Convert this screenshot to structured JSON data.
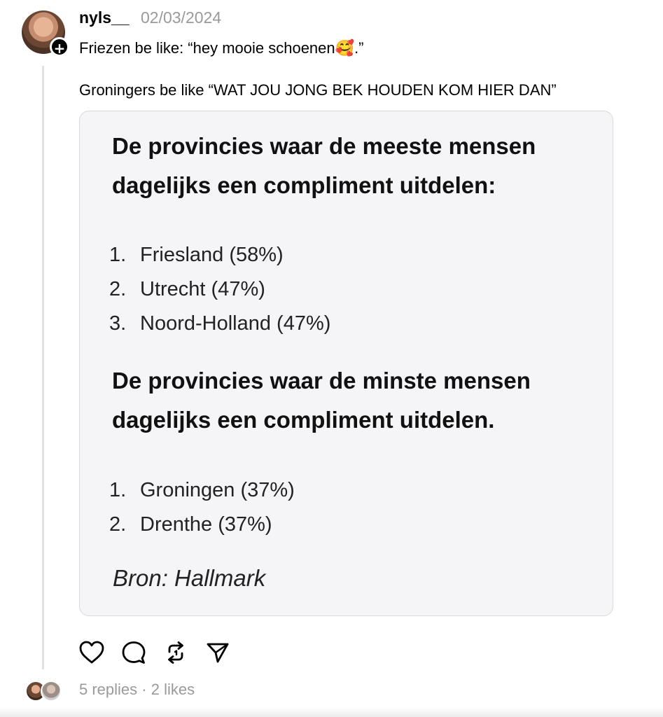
{
  "post": {
    "username": "nyls__",
    "timestamp": "02/03/2024",
    "line1": "Friezen be like: “hey mooie schoenen",
    "emoji": "🥰",
    "line1_end": ".”",
    "line2": "Groningers be like “WAT JOU JONG BEK HOUDEN KOM HIER DAN”"
  },
  "image": {
    "heading1": "De provincies waar de meeste mensen dagelijks een compliment uitdelen:",
    "most": [
      {
        "num": "1.",
        "text": "Friesland (58%)"
      },
      {
        "num": "2.",
        "text": "Utrecht (47%)"
      },
      {
        "num": "3.",
        "text": "Noord-Holland (47%)"
      }
    ],
    "heading2": "De provincies waar de minste mensen dagelijks een compliment uitdelen.",
    "least": [
      {
        "num": "1.",
        "text": "Groningen (37%)"
      },
      {
        "num": "2.",
        "text": "Drenthe (37%)"
      }
    ],
    "source": "Bron: Hallmark"
  },
  "actions": {
    "icons": [
      "heart-icon",
      "comment-icon",
      "repost-icon",
      "share-icon"
    ]
  },
  "stats": {
    "replies": "5 replies",
    "separator": "·",
    "likes": "2 likes"
  },
  "colors": {
    "muted": "#9a9a9a",
    "card_bg": "#f5f5f7",
    "thread_line": "#e1e1e1"
  }
}
